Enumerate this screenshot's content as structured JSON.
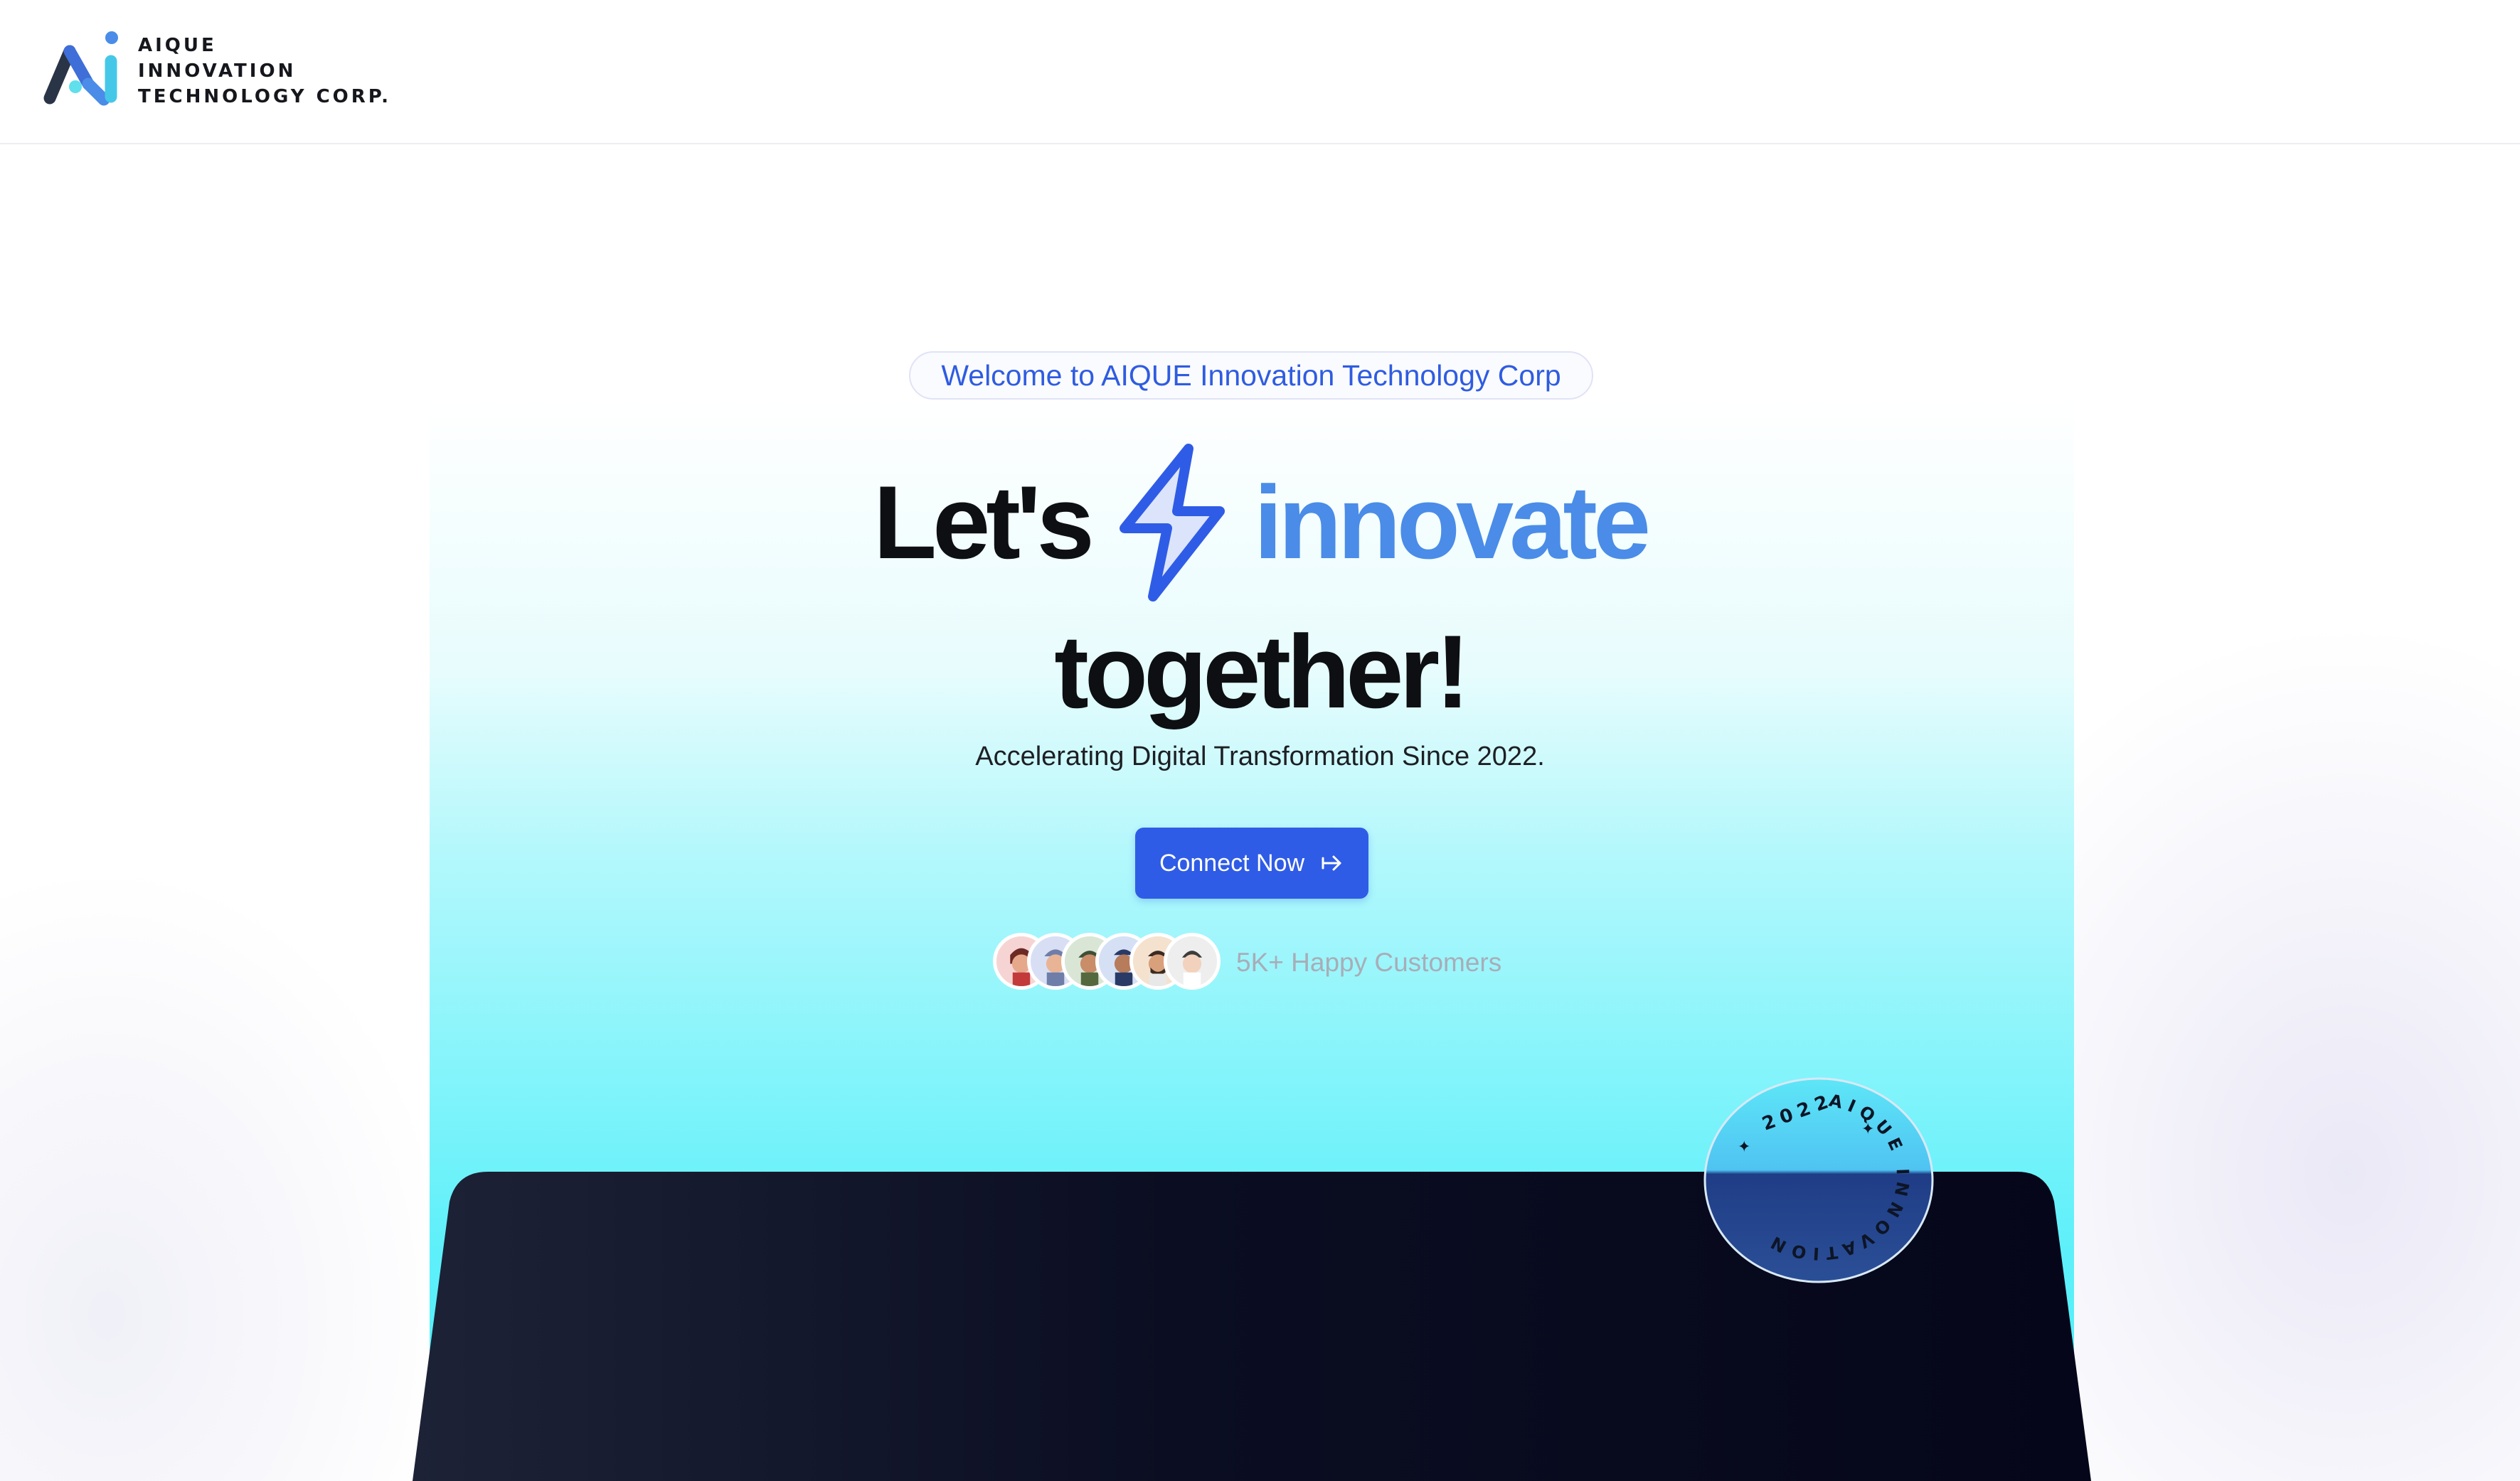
{
  "header": {
    "brand_lines": [
      "AIQUE",
      "INNOVATION",
      "TECHNOLOGY CORP."
    ],
    "logo_icon": "aique-logo-icon"
  },
  "hero": {
    "welcome_pill": "Welcome to AIQUE Innovation Technology Corp",
    "headline_word_1": "Let's",
    "headline_icon": "lightning-bolt-icon",
    "headline_word_2": "innovate",
    "headline_line_2": "together!",
    "subtitle": "Accelerating Digital Transformation Since 2022.",
    "cta_label": "Connect Now",
    "cta_icon": "arrow-right-icon",
    "customers_text": "5K+ Happy Customers",
    "avatar_count": 6
  },
  "badge": {
    "year": "2022",
    "ring_text": "AIQUE INNOVATION"
  },
  "colors": {
    "brand_blue": "#2f5ce6",
    "accent_blue": "#4a8ce8",
    "cyan": "#48eef9",
    "dark": "#0b0f22"
  }
}
